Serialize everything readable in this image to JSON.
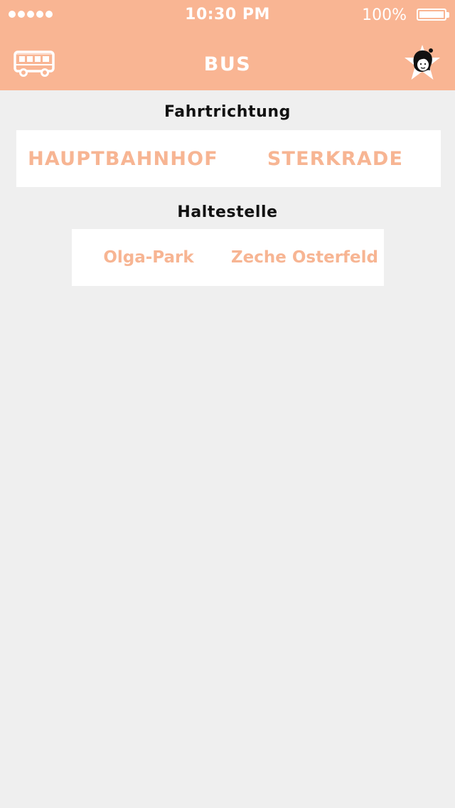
{
  "status_bar": {
    "time": "10:30 PM",
    "battery": "100%",
    "signal_icon": "signal-dots-icon",
    "battery_icon": "battery-full-icon"
  },
  "header": {
    "title": "BUS",
    "left_icon": "bus-icon",
    "right_icon": "star-avatar-icon",
    "background_color": "#f9b593"
  },
  "direction": {
    "label": "Fahrtrichtung",
    "options": [
      "HAUPTBAHNHOF",
      "STERKRADE"
    ]
  },
  "stop": {
    "label": "Haltestelle",
    "options": [
      "Olga-Park",
      "Zeche Osterfeld"
    ]
  },
  "colors": {
    "accent": "#f9b593",
    "option_text": "#f7b593",
    "background": "#efefef"
  }
}
